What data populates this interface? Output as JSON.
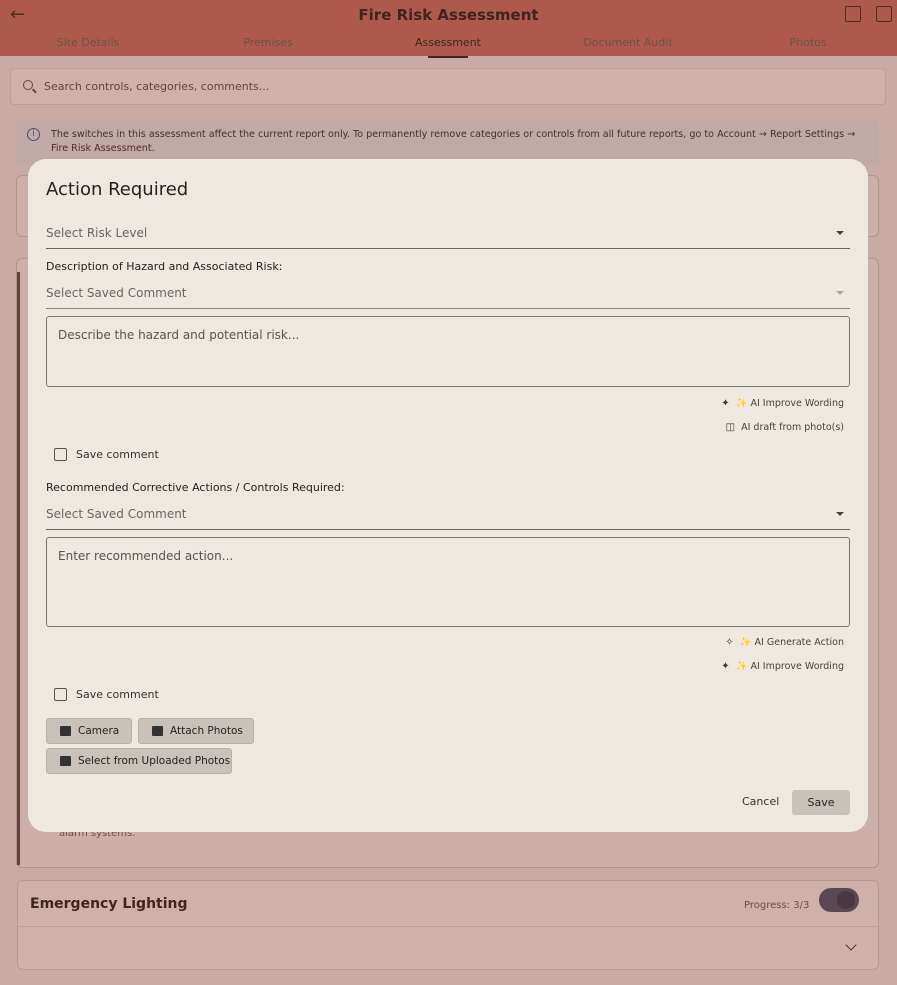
{
  "app": {
    "title": "Fire Risk Assessment",
    "back_icon": "arrow-left-icon",
    "tabs": [
      {
        "label": "Site Details"
      },
      {
        "label": "Premises"
      },
      {
        "label": "Assessment"
      },
      {
        "label": "Document Audit"
      },
      {
        "label": "Photos"
      }
    ],
    "active_tab": "Assessment"
  },
  "search": {
    "placeholder": "Search controls, categories, comments..."
  },
  "info_banner": {
    "text": "The switches in this assessment affect the current report only. To permanently remove categories or controls from all future reports, go to Account → Report Settings → Fire Risk Assessment."
  },
  "background": {
    "partial_text": "alarm systems.",
    "emergency_card": {
      "title": "Emergency Lighting",
      "progress": "Progress: 3/3",
      "toggle_on": true
    }
  },
  "dialog": {
    "title": "Action Required",
    "risk_level": {
      "placeholder": "Select Risk Level"
    },
    "hazard": {
      "label": "Description of Hazard and Associated Risk:",
      "saved_comment_placeholder": "Select Saved Comment",
      "textarea_placeholder": "Describe the hazard and potential risk...",
      "ai_improve": "✨ AI Improve Wording",
      "ai_draft": "AI draft from photo(s)",
      "save_comment": "Save comment"
    },
    "actions": {
      "label": "Recommended Corrective Actions / Controls Required:",
      "saved_comment_placeholder": "Select Saved Comment",
      "textarea_placeholder": "Enter recommended action...",
      "ai_generate": "✨ AI Generate Action",
      "ai_improve": "✨ AI Improve Wording",
      "save_comment": "Save comment"
    },
    "photo_buttons": {
      "camera": "Camera",
      "attach": "Attach Photos",
      "select_uploaded": "Select from Uploaded Photos"
    },
    "footer": {
      "cancel": "Cancel",
      "save": "Save"
    }
  },
  "colors": {
    "header_tint": "#c9766a",
    "dialog_bg": "#efe8e0",
    "button_bg": "#c9c2ba"
  }
}
